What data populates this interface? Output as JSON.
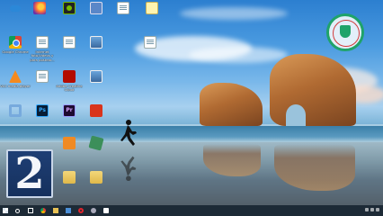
{
  "overlay": {
    "episode_number": "2"
  },
  "desktop": {
    "icons": [
      {
        "name": "cloud-app-icon",
        "label": "",
        "glyph": "g-cloud"
      },
      {
        "name": "firefox-icon",
        "label": "",
        "glyph": "g-firefox"
      },
      {
        "name": "nvidia-icon",
        "label": "",
        "glyph": "g-nvidia"
      },
      {
        "name": "monitor-icon",
        "label": "",
        "glyph": "g-monitor"
      },
      {
        "name": "file-icon-1",
        "label": "",
        "glyph": "g-doc"
      },
      {
        "name": "note-icon",
        "label": "",
        "glyph": "g-note"
      },
      {
        "name": "chrome-icon",
        "label": "Google Chrome",
        "glyph": "g-chrome"
      },
      {
        "name": "doc-icon-1",
        "label": "Internet foto/videos y para postear...",
        "glyph": "g-doc"
      },
      {
        "name": "doc-icon-2",
        "label": "",
        "glyph": "g-doc"
      },
      {
        "name": "photo-icon",
        "label": "",
        "glyph": "g-photo"
      },
      {
        "name": "doc-icon-3",
        "label": "",
        "glyph": "g-doc"
      },
      {
        "name": "vlc-icon",
        "label": "VLC media player",
        "glyph": "g-vlc"
      },
      {
        "name": "doc-icon-4",
        "label": "",
        "glyph": "g-doc"
      },
      {
        "name": "acrobat-icon",
        "label": "Adobe Creative Cloud",
        "glyph": "g-adobe-red"
      },
      {
        "name": "image-icon",
        "label": "",
        "glyph": "g-photo"
      },
      {
        "name": "gear-app-icon",
        "label": "",
        "glyph": "g-gear"
      },
      {
        "name": "photoshop-icon",
        "label": "",
        "glyph": "g-ps"
      },
      {
        "name": "premiere-icon",
        "label": "",
        "glyph": "g-pr"
      },
      {
        "name": "paint-icon",
        "label": "",
        "glyph": "g-red-square"
      },
      {
        "name": "orange-app-icon",
        "label": "",
        "glyph": "g-orange-sheet"
      },
      {
        "name": "green-app-icon",
        "label": "",
        "glyph": "g-green-box"
      },
      {
        "name": "folder-icon-1",
        "label": "",
        "glyph": "g-folder"
      },
      {
        "name": "folder-icon-2",
        "label": "",
        "glyph": "g-folder"
      }
    ]
  },
  "taskbar": {
    "items": [
      "start",
      "search",
      "task-view",
      "chrome",
      "file-explorer",
      "store",
      "opera",
      "settings",
      "camera"
    ]
  }
}
